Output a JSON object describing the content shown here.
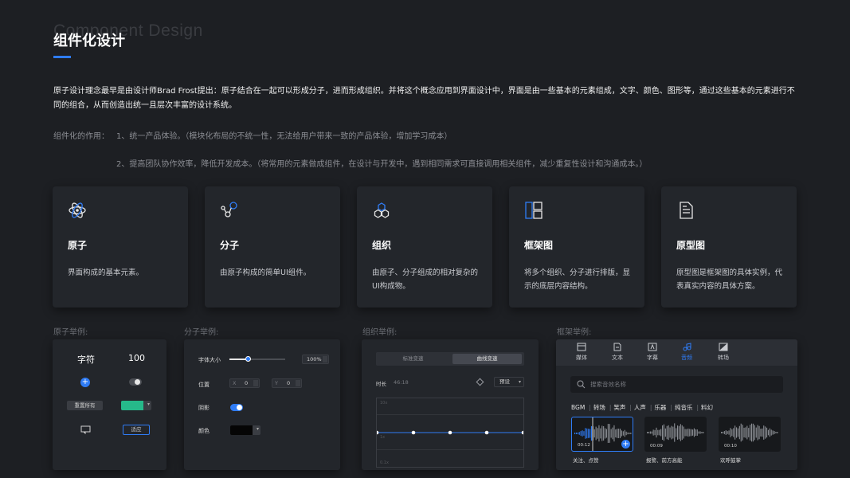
{
  "header": {
    "bg_title": "Component Design",
    "title": "组件化设计"
  },
  "intro": "原子设计理念最早是由设计师Brad Frost提出：原子结合在一起可以形成分子，进而形成组织。并将这个概念应用到界面设计中，界面是由一些基本的元素组成，文字、颜色、图形等，通过这些基本的元素进行不同的组合，从而创造出统一且层次丰富的设计系统。",
  "roles": {
    "label": "组件化的作用：",
    "item1": "1、统一产品体验。（模块化布局的不统一性，无法给用户带来一致的产品体验，增加学习成本）",
    "item2": "2、提高团队协作效率，降低开发成本。（将常用的元素做成组件，在设计与开发中，遇到相同需求可直接调用相关组件，减少重复性设计和沟通成本。）"
  },
  "cards": [
    {
      "icon": "atom-icon",
      "name": "原子",
      "desc": "界面构成的基本元素。"
    },
    {
      "icon": "molecule-icon",
      "name": "分子",
      "desc": "由原子构成的简单UI组件。"
    },
    {
      "icon": "organism-icon",
      "name": "组织",
      "desc": "由原子、分子组成的相对复杂的UI构成物。"
    },
    {
      "icon": "wireframe-icon",
      "name": "框架图",
      "desc": "将多个组织、分子进行排版，显示的底层内容结构。"
    },
    {
      "icon": "document-icon",
      "name": "原型图",
      "desc": "原型图是框架图的具体实例，代表真实内容的具体方案。"
    }
  ],
  "examples": {
    "atom_label": "原子举例:",
    "molecule_label": "分子举例:",
    "organism_label": "组织举例:",
    "template_label": "框架举例:"
  },
  "atom_panel": {
    "text_sample": "字符",
    "number_sample": "100",
    "reset_button": "重置所有",
    "swatch_color": "#26b98a",
    "apply_button": "适应"
  },
  "molecule_panel": {
    "font_size_label": "字体大小",
    "font_size_value": "100%",
    "font_size_level": 0.33,
    "position_label": "位置",
    "x_prefix": "X",
    "x_value": "0",
    "y_prefix": "Y",
    "y_value": "0",
    "shadow_label": "阴影",
    "shadow_on": true,
    "color_label": "颜色",
    "color_value": "#050505"
  },
  "organism_panel": {
    "seg_option1": "标准变速",
    "seg_option2": "曲线变速",
    "duration_label": "时长",
    "duration_value": "46:18",
    "preset_label": "预设",
    "grid_top": "10x",
    "grid_mid": "1x",
    "grid_bottom": "0.1x",
    "curve_points": 5
  },
  "template_panel": {
    "tabs": [
      {
        "label": "媒体",
        "icon": "media-icon",
        "active": false
      },
      {
        "label": "文本",
        "icon": "text-icon",
        "active": false
      },
      {
        "label": "字幕",
        "icon": "caption-icon",
        "active": false
      },
      {
        "label": "音频",
        "icon": "audio-icon",
        "active": true
      },
      {
        "label": "转场",
        "icon": "transition-icon",
        "active": false
      }
    ],
    "search_placeholder": "搜索音效名称",
    "categories": [
      "BGM",
      "转场",
      "笑声",
      "人声",
      "乐器",
      "纯音乐",
      "料幻"
    ],
    "clips": [
      {
        "time": "00:12",
        "name": "关注、点赞",
        "selected": true
      },
      {
        "time": "00:09",
        "name": "报警、前方高能",
        "selected": false
      },
      {
        "time": "00:10",
        "name": "欢呼鼓掌",
        "selected": false
      }
    ],
    "accent": "#2f7cf6"
  }
}
